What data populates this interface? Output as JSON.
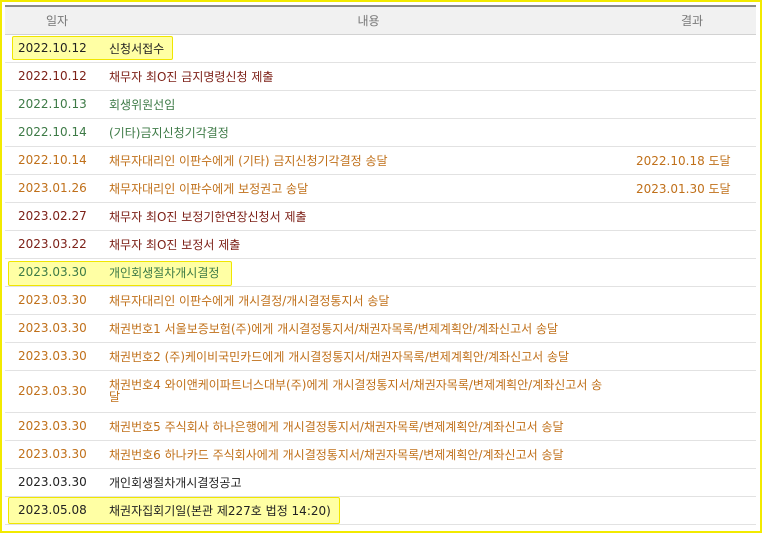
{
  "table": {
    "headers": {
      "date": "일자",
      "content": "내용",
      "result": "결과"
    },
    "rows": [
      {
        "date": "2022.10.12",
        "content": "신청서접수",
        "result": "",
        "color": "black",
        "highlighted": true
      },
      {
        "date": "2022.10.12",
        "content": "채무자 최O진 금지명령신청 제출",
        "result": "",
        "color": "maroon",
        "highlighted": false
      },
      {
        "date": "2022.10.13",
        "content": "회생위원선임",
        "result": "",
        "color": "green",
        "highlighted": false
      },
      {
        "date": "2022.10.14",
        "content": "(기타)금지신청기각결정",
        "result": "",
        "color": "green",
        "highlighted": false
      },
      {
        "date": "2022.10.14",
        "content": "채무자대리인 이판수에게 (기타) 금지신청기각결정 송달",
        "result": "2022.10.18 도달",
        "color": "orange",
        "highlighted": false
      },
      {
        "date": "2023.01.26",
        "content": "채무자대리인 이판수에게 보정권고 송달",
        "result": "2023.01.30 도달",
        "color": "orange",
        "highlighted": false
      },
      {
        "date": "2023.02.27",
        "content": "채무자 최O진 보정기한연장신청서 제출",
        "result": "",
        "color": "maroon",
        "highlighted": false
      },
      {
        "date": "2023.03.22",
        "content": "채무자 최O진 보정서 제출",
        "result": "",
        "color": "maroon",
        "highlighted": false
      },
      {
        "date": "2023.03.30",
        "content": "개인회생절차개시결정",
        "result": "",
        "color": "green",
        "highlighted": true
      },
      {
        "date": "2023.03.30",
        "content": "채무자대리인 이판수에게 개시결정/개시결정통지서 송달",
        "result": "",
        "color": "orange",
        "highlighted": false
      },
      {
        "date": "2023.03.30",
        "content": "채권번호1 서울보증보험(주)에게 개시결정통지서/채권자목록/변제계획안/계좌신고서 송달",
        "result": "",
        "color": "orange",
        "highlighted": false
      },
      {
        "date": "2023.03.30",
        "content": "채권번호2 (주)케이비국민카드에게 개시결정통지서/채권자목록/변제계획안/계좌신고서 송달",
        "result": "",
        "color": "orange",
        "highlighted": false
      },
      {
        "date": "2023.03.30",
        "content": "채권번호4 와이앤케이파트너스대부(주)에게 개시결정통지서/채권자목록/변제계획안/계좌신고서 송달",
        "result": "",
        "color": "orange",
        "highlighted": false,
        "tall": true
      },
      {
        "date": "2023.03.30",
        "content": "채권번호5 주식회사 하나은행에게 개시결정통지서/채권자목록/변제계획안/계좌신고서 송달",
        "result": "",
        "color": "orange",
        "highlighted": false
      },
      {
        "date": "2023.03.30",
        "content": "채권번호6 하나카드 주식회사에게 개시결정통지서/채권자목록/변제계획안/계좌신고서 송달",
        "result": "",
        "color": "orange",
        "highlighted": false
      },
      {
        "date": "2023.03.30",
        "content": "개인회생절차개시결정공고",
        "result": "",
        "color": "black",
        "highlighted": false
      },
      {
        "date": "2023.05.08",
        "content": "채권자집회기일(본관 제227호 법정 14:20)",
        "result": "",
        "color": "black",
        "highlighted": true
      }
    ]
  },
  "colors": {
    "orange": "#c0701a",
    "maroon": "#7d2118",
    "green": "#3d7a46",
    "black": "#222222",
    "highlight": "#ffff5a",
    "frame": "#f2ea00"
  }
}
